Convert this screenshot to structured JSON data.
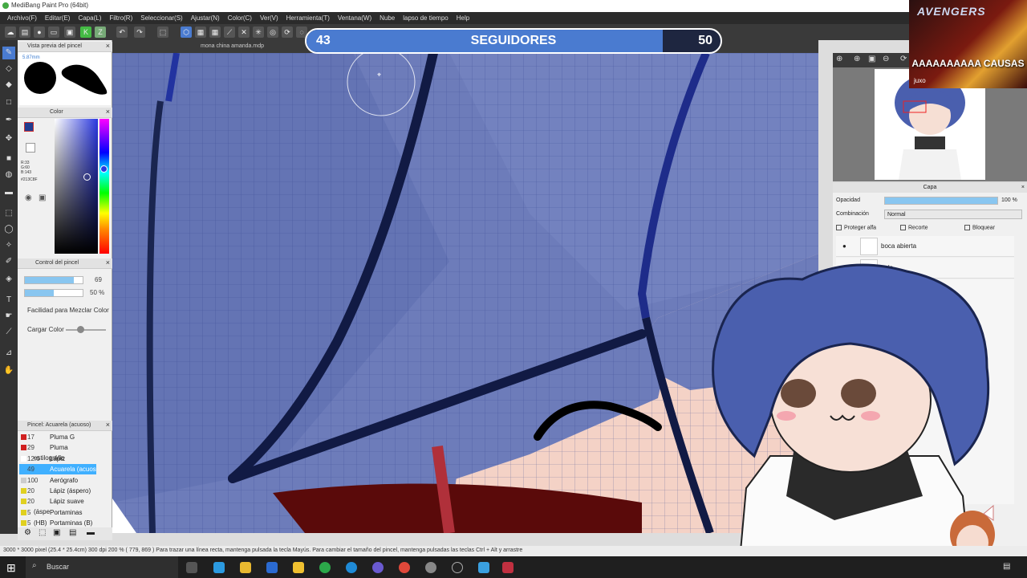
{
  "window": {
    "title": "MediBang Paint Pro (64bit)"
  },
  "menu": [
    "Archivo(F)",
    "Editar(E)",
    "Capa(L)",
    "Filtro(R)",
    "Seleccionar(S)",
    "Ajustar(N)",
    "Color(C)",
    "Ver(V)",
    "Herramienta(T)",
    "Ventana(W)",
    "Nube",
    "lapso de tiempo",
    "Help"
  ],
  "document": {
    "tab": "mona china amanda.mdp"
  },
  "brush_preview": {
    "title": "Vista previa del pincel",
    "size": "5.87mm"
  },
  "color_panel": {
    "title": "Color",
    "r": "R:33",
    "g": "G:60",
    "b": "B:143",
    "hex": "#213C8F"
  },
  "brush_control": {
    "title": "Control del pincel",
    "size_value": "69",
    "opacity_value": "50 %",
    "size_fill": 0.85,
    "opacity_fill": 0.5,
    "mix_label": "Facilidad para Mezclar Color",
    "load_label": "Cargar Color"
  },
  "brush_list": {
    "title": "Pincel: Acuarela (acuoso)",
    "items": [
      {
        "size": "17",
        "name": "Pluma G",
        "color": "#d02020"
      },
      {
        "size": "29",
        "name": "Pluma estilográfic",
        "color": "#d02020"
      },
      {
        "size": "12.6",
        "name": "Lápiz",
        "color": "#ffffff"
      },
      {
        "size": "49",
        "name": "Acuarela (acuos",
        "color": "#40b0ff"
      },
      {
        "size": "100",
        "name": "Aerógrafo",
        "color": "#cccccc"
      },
      {
        "size": "20",
        "name": "Lápiz (áspero)",
        "color": "#e0d020"
      },
      {
        "size": "20",
        "name": "Lápiz suave (áspe",
        "color": "#e0d020"
      },
      {
        "size": "5",
        "name": "Portaminas (HB)",
        "color": "#e0d020"
      },
      {
        "size": "5",
        "name": "Portaminas (B)",
        "color": "#e0d020"
      }
    ]
  },
  "overlay": {
    "follow_current": "43",
    "follow_goal": "50",
    "follow_label": "SEGUIDORES",
    "follow_fraction": 0.86
  },
  "poster": {
    "brand": "AVENGERS",
    "caption": "AAAAAAAAAA CAUSAS",
    "credit": "juxo"
  },
  "layers": {
    "title": "Capa",
    "opacity_label": "Opacidad",
    "opacity_value": "100 %",
    "opacity_fill": 1.0,
    "blend_label": "Combinación",
    "blend_value": "Normal",
    "protect_alpha": "Proteger alfa",
    "clip": "Recorte",
    "lock": "Bloquear",
    "items": [
      {
        "name": "boca abierta"
      },
      {
        "name": "pelo"
      }
    ]
  },
  "status": {
    "text": "3000 * 3000 pixel  (25.4 * 25.4cm)  300 dpi  200 %  ( 779, 869 )  Para trazar una línea recta, mantenga pulsada la tecla Mayús. Para cambiar el tamaño del pincel, mantenga pulsadas las teclas Ctrl + Alt y arrastre"
  },
  "taskbar": {
    "search_placeholder": "Buscar"
  },
  "colors": {
    "accent": "#213C8F",
    "hair": "#4a5fae",
    "menubar": "#2b2b2b"
  }
}
